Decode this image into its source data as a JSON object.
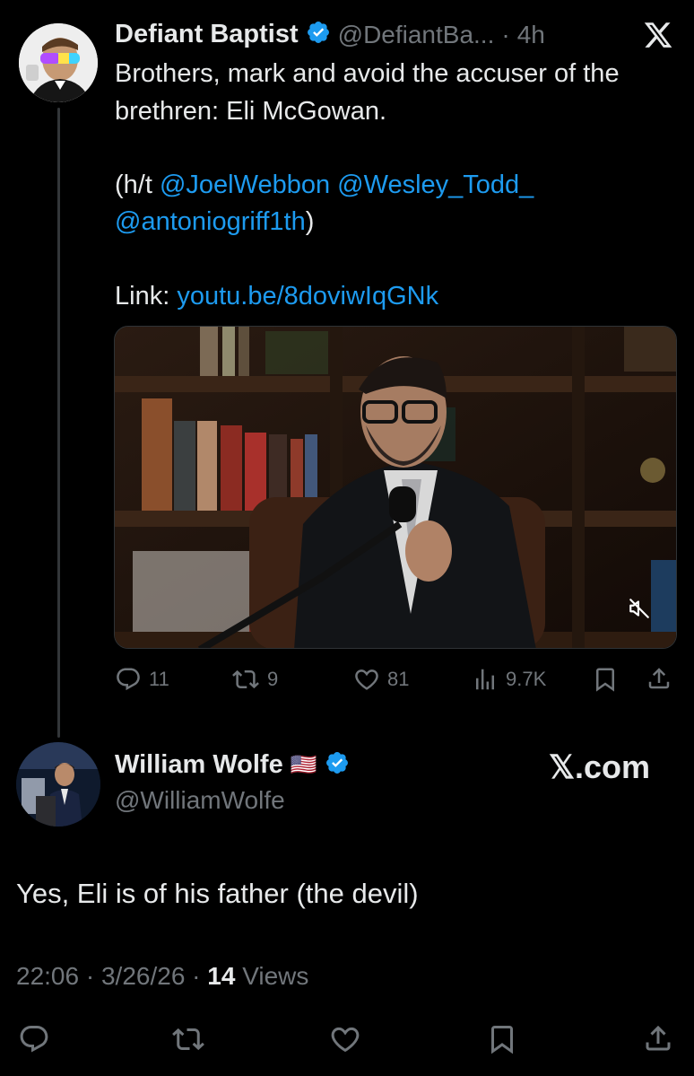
{
  "quoted": {
    "author": "Defiant Baptist",
    "handle": "@DefiantBa...",
    "separator": "·",
    "time": "4h",
    "line1": "Brothers, mark and avoid the accuser of the",
    "line2": "brethren: Eli McGowan.",
    "ht_open": "(h/t ",
    "mention1": "@JoelWebbon",
    "mention2": "@Wesley_Todd_",
    "mention3": "@antoniogriff1th",
    "ht_close": ")",
    "link_label": "Link: ",
    "link_url": "youtu.be/8doviwIqGNk",
    "stats": {
      "replies": "11",
      "reposts": "9",
      "likes": "81",
      "views": "9.7K"
    }
  },
  "reply": {
    "author": "William Wolfe",
    "flag": "🇺🇸",
    "handle": "@WilliamWolfe",
    "brand": "𝕏.com",
    "text": "Yes, Eli is of his father (the devil)",
    "time": "22:06",
    "date": "3/26/26",
    "views_count": "14",
    "views_label": "Views",
    "dot": "·"
  },
  "colors": {
    "background": "#000000",
    "text": "#e7e9ea",
    "muted": "#71767b",
    "link": "#1d9bf0",
    "verified": "#1d9bf0"
  },
  "icons": [
    "x-logo-icon",
    "verified-badge-icon",
    "reply-icon",
    "repost-icon",
    "like-icon",
    "views-icon",
    "bookmark-icon",
    "share-icon",
    "mute-icon"
  ]
}
